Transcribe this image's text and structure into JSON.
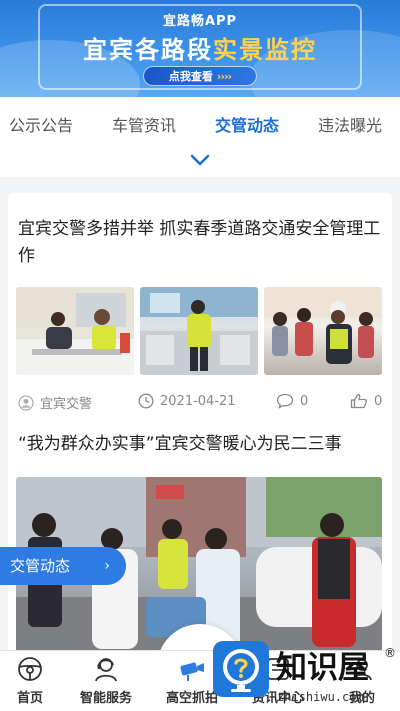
{
  "banner": {
    "app_name": "宜路畅APP",
    "title_white": "宜宾各路段",
    "title_yellow": "实景监控",
    "button_label": "点我查看",
    "button_arrows": "››››"
  },
  "tabs": [
    {
      "label": "公示公告",
      "active": false
    },
    {
      "label": "车管资讯",
      "active": false
    },
    {
      "label": "交管动态",
      "active": true
    },
    {
      "label": "违法曝光",
      "active": false
    }
  ],
  "news": [
    {
      "title": "宜宾交警多措并举 抓实春季道路交通安全管理工作",
      "source": "宜宾交警",
      "date": "2021-04-21",
      "comments": "0",
      "likes": "0"
    },
    {
      "title": "“我为群众办实事”宜宾交警暖心为民二三事"
    }
  ],
  "float_button": {
    "label": "交管动态",
    "chevron": "›"
  },
  "bottom_nav": [
    {
      "label": "首页",
      "icon": "steering-wheel-icon"
    },
    {
      "label": "智能服务",
      "icon": "service-person-icon"
    },
    {
      "label": "高空抓拍",
      "icon": "camera-icon"
    },
    {
      "label": "资讯中心",
      "icon": "news-icon"
    },
    {
      "label": "我的",
      "icon": "profile-icon"
    }
  ],
  "watermark": {
    "brand": "知识屋",
    "url": "zhishiwu.com",
    "reg": "®"
  },
  "colors": {
    "accent": "#1b6fd6",
    "banner_blue": "#3c92ea",
    "highlight_yellow": "#ffd34a"
  }
}
